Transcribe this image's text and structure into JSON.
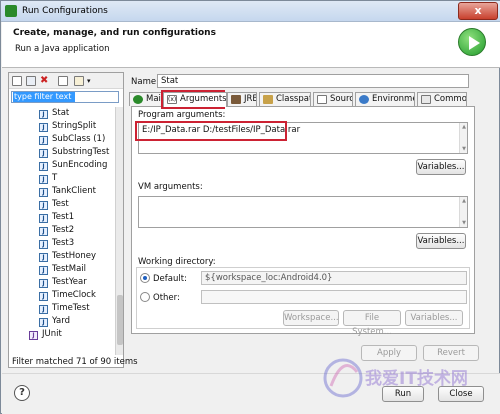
{
  "window": {
    "title": "Run Configurations",
    "close_label": "x"
  },
  "header": {
    "title": "Create, manage, and run configurations",
    "subtitle": "Run a Java application"
  },
  "left": {
    "filter_text": "type filter text",
    "items": [
      "Stat",
      "StringSplit",
      "SubClass (1)",
      "SubstringTest",
      "SunEncoding",
      "T",
      "TankClient",
      "Test",
      "Test1",
      "Test2",
      "Test3",
      "TestHoney",
      "TestMail",
      "TestYear",
      "TimeClock",
      "TimeTest",
      "Yard"
    ],
    "junit_label": "JUnit",
    "status": "Filter matched 71 of 90 items"
  },
  "right": {
    "name_label": "Name:",
    "name_value": "Stat",
    "tabs": [
      "Main",
      "Arguments",
      "JRE",
      "Classpath",
      "Source",
      "Environment",
      "Common"
    ],
    "program_args_label": "Program arguments:",
    "program_args_value": "E:/IP_Data.rar D:/testFiles/IP_Data.rar",
    "variables_label": "Variables...",
    "vm_args_label": "VM arguments:",
    "vm_args_value": "",
    "working_dir_label": "Working directory:",
    "default_label": "Default:",
    "default_value": "${workspace_loc:Android4.0}",
    "other_label": "Other:",
    "workspace_btn": "Workspace...",
    "filesystem_btn": "File System...",
    "apply_btn": "Apply",
    "revert_btn": "Revert"
  },
  "bottom": {
    "help_symbol": "?",
    "run_btn": "Run",
    "close_btn": "Close"
  },
  "watermark": {
    "text": "我爱IT技术网"
  },
  "colors": {
    "highlight": "#cc2233",
    "selection": "#3399ff",
    "run_green": "#1f9a2a"
  }
}
